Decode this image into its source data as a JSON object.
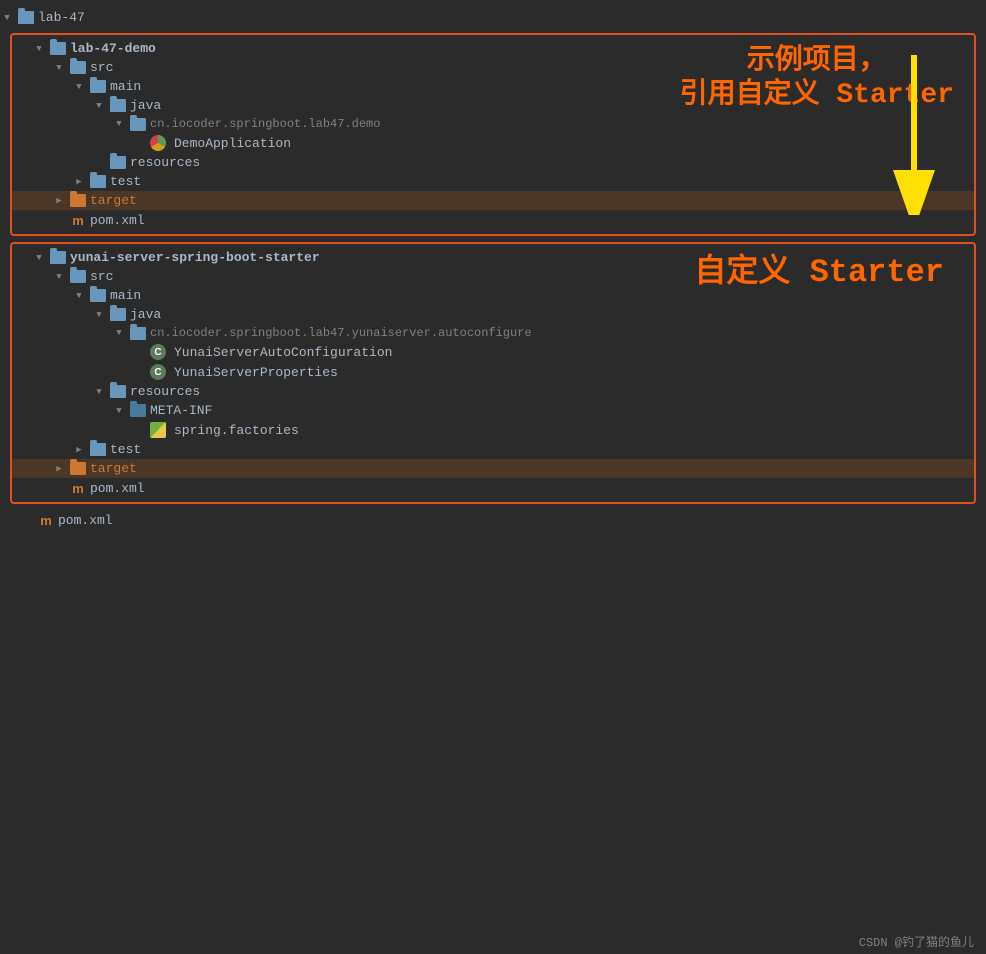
{
  "root": {
    "label": "lab-47"
  },
  "section1": {
    "label": "lab-47-demo",
    "annotation_line1": "示例项目，",
    "annotation_line2": "引用自定义 Starter",
    "items": [
      {
        "level": 1,
        "type": "folder-blue",
        "arrow": "down",
        "label": "src"
      },
      {
        "level": 2,
        "type": "folder-blue",
        "arrow": "down",
        "label": "main"
      },
      {
        "level": 3,
        "type": "folder-blue",
        "arrow": "down",
        "label": "java"
      },
      {
        "level": 4,
        "type": "folder-blue",
        "arrow": "down",
        "label": "cn.iocoder.springboot.lab47.demo"
      },
      {
        "level": 5,
        "type": "icon-app",
        "arrow": "none",
        "label": "DemoApplication"
      },
      {
        "level": 3,
        "type": "folder-res",
        "arrow": "none",
        "label": "resources"
      },
      {
        "level": 2,
        "type": "folder-blue",
        "arrow": "right",
        "label": "test"
      },
      {
        "level": 1,
        "type": "folder-orange",
        "arrow": "right",
        "label": "target",
        "highlight": true
      },
      {
        "level": 1,
        "type": "maven-m",
        "arrow": "none",
        "label": "pom.xml"
      }
    ]
  },
  "section2": {
    "label": "yunai-server-spring-boot-starter",
    "annotation_line1": "自定义 Starter",
    "items": [
      {
        "level": 1,
        "type": "folder-blue",
        "arrow": "down",
        "label": "src"
      },
      {
        "level": 2,
        "type": "folder-blue",
        "arrow": "down",
        "label": "main"
      },
      {
        "level": 3,
        "type": "folder-blue",
        "arrow": "down",
        "label": "java"
      },
      {
        "level": 4,
        "type": "folder-blue",
        "arrow": "down",
        "label": "cn.iocoder.springboot.lab47.yunaiserver.autoconfigure"
      },
      {
        "level": 5,
        "type": "icon-class",
        "arrow": "none",
        "label": "YunaiServerAutoConfiguration"
      },
      {
        "level": 5,
        "type": "icon-class",
        "arrow": "none",
        "label": "YunaiServerProperties"
      },
      {
        "level": 3,
        "type": "folder-res",
        "arrow": "down",
        "label": "resources"
      },
      {
        "level": 4,
        "type": "folder-metainf",
        "arrow": "down",
        "label": "META-INF"
      },
      {
        "level": 5,
        "type": "icon-factories",
        "arrow": "none",
        "label": "spring.factories"
      },
      {
        "level": 2,
        "type": "folder-blue",
        "arrow": "right",
        "label": "test"
      },
      {
        "level": 1,
        "type": "folder-orange",
        "arrow": "right",
        "label": "target",
        "highlight": true
      },
      {
        "level": 1,
        "type": "maven-m",
        "arrow": "none",
        "label": "pom.xml"
      }
    ]
  },
  "footer": {
    "label": "pom.xml",
    "credit": "CSDN @钓了猫的鱼儿"
  }
}
